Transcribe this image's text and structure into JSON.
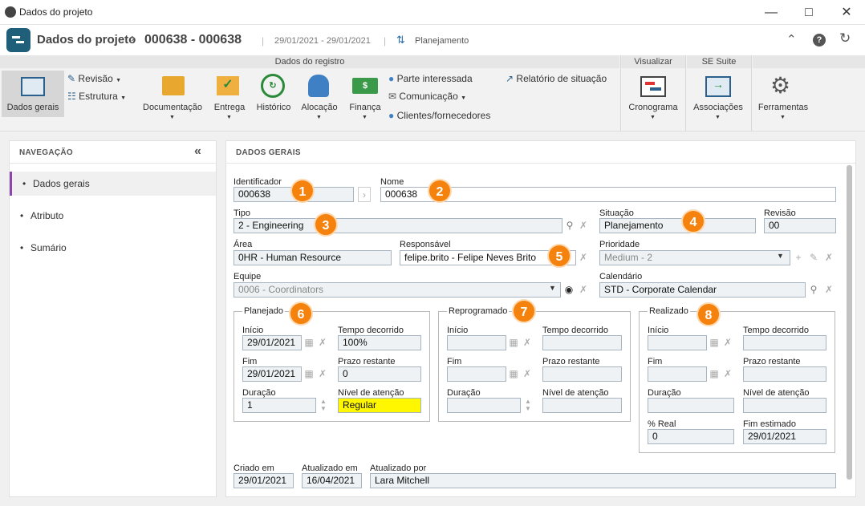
{
  "window": {
    "title": "Dados do projeto"
  },
  "header": {
    "title": "Dados do projeto",
    "id": "000638 - 000638",
    "dates": "29/01/2021 - 29/01/2021",
    "phase": "Planejamento"
  },
  "ribbon": {
    "groups": {
      "registro": "Dados do registro",
      "visualizar": "Visualizar",
      "suite": "SE Suite"
    },
    "dados_gerais": "Dados gerais",
    "revisao": "Revisão",
    "estrutura": "Estrutura",
    "documentacao": "Documentação",
    "entrega": "Entrega",
    "historico": "Histórico",
    "alocacao": "Alocação",
    "financa": "Finança",
    "parte": "Parte interessada",
    "comunicacao": "Comunicação",
    "clientes": "Clientes/fornecedores",
    "relatorio": "Relatório de situação",
    "cronograma": "Cronograma",
    "associacoes": "Associações",
    "ferramentas": "Ferramentas"
  },
  "nav": {
    "title": "NAVEGAÇÃO",
    "items": [
      "Dados gerais",
      "Atributo",
      "Sumário"
    ]
  },
  "main": {
    "title": "DADOS GERAIS"
  },
  "form": {
    "identificador": {
      "label": "Identificador",
      "value": "000638"
    },
    "nome": {
      "label": "Nome",
      "value": "000638"
    },
    "tipo": {
      "label": "Tipo",
      "value": "2 - Engineering"
    },
    "situacao": {
      "label": "Situação",
      "value": "Planejamento"
    },
    "revisao": {
      "label": "Revisão",
      "value": "00"
    },
    "area": {
      "label": "Área",
      "value": "0HR - Human Resource"
    },
    "responsavel": {
      "label": "Responsável",
      "value": "felipe.brito - Felipe Neves Brito"
    },
    "prioridade": {
      "label": "Prioridade",
      "value": "Medium - 2"
    },
    "equipe": {
      "label": "Equipe",
      "value": "0006 - Coordinators"
    },
    "calendario": {
      "label": "Calendário",
      "value": "STD - Corporate Calendar"
    }
  },
  "labels": {
    "inicio": "Início",
    "fim": "Fim",
    "duracao": "Duração",
    "tempo": "Tempo decorrido",
    "prazo": "Prazo restante",
    "nivel": "Nível de atenção",
    "real": "% Real",
    "fimest": "Fim estimado"
  },
  "planejado": {
    "title": "Planejado",
    "inicio": "29/01/2021",
    "fim": "29/01/2021",
    "duracao": "1",
    "tempo": "100%",
    "prazo": "0",
    "nivel": "Regular"
  },
  "reprogramado": {
    "title": "Reprogramado"
  },
  "realizado": {
    "title": "Realizado",
    "real": "0",
    "fimest": "29/01/2021"
  },
  "footer": {
    "criado_label": "Criado em",
    "criado": "29/01/2021",
    "atualizado_label": "Atualizado em",
    "atualizado": "16/04/2021",
    "por_label": "Atualizado por",
    "por": "Lara Mitchell"
  },
  "badges": [
    "1",
    "2",
    "3",
    "4",
    "5",
    "6",
    "7",
    "8"
  ],
  "colors": {
    "badge": "#f5820d",
    "accent": "#8e44ad",
    "attention": "#fff700"
  }
}
